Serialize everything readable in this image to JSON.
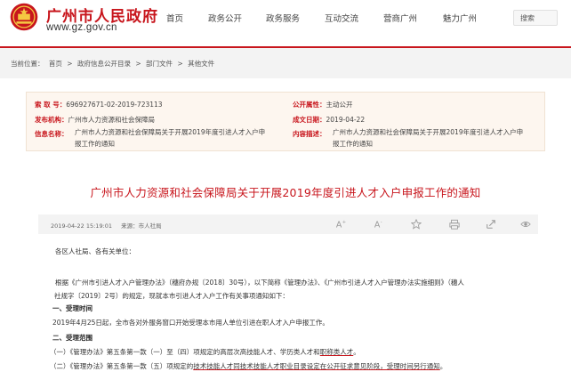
{
  "header": {
    "site_title": "广州市人民政府",
    "site_url": "www.gz.gov.cn",
    "nav": [
      "首页",
      "政务公开",
      "政务服务",
      "互动交流",
      "营商广州",
      "魅力广州"
    ],
    "search_label": "搜索",
    "accent_color": "#c8161d"
  },
  "breadcrumb": {
    "prefix": "当前位置：",
    "items": [
      "首页",
      "政府信息公开目录",
      "部门文件",
      "其他文件"
    ],
    "separator": ">"
  },
  "meta": {
    "index_label": "索 取 号：",
    "index_value": "696927671-02-2019-723113",
    "type_label": "公开属性：",
    "type_value": "主动公开",
    "issuer_label": "发布机构：",
    "issuer_value": "广州市人力资源和社会保障局",
    "date_label": "成文日期：",
    "date_value": "2019-04-22",
    "name_label": "信息名称：",
    "name_value_line1": "广州市人力资源和社会保障局关于开展2019年度引进人才入户申",
    "name_value_line2": "报工作的通知",
    "desc_label": "内容描述：",
    "desc_value_line1": "广州市人力资源和社会保障局关于开展2019年度引进人才入户申",
    "desc_value_line2": "报工作的通知"
  },
  "document": {
    "title": "广州市人力资源和社会保障局关于开展2019年度引进人才入户申报工作的通知",
    "published": "2019-04-22 15:19:01",
    "source_label": "来源：",
    "source_value": "市人社局",
    "toolbar_icons": [
      "font-larger-icon",
      "font-smaller-icon",
      "star-icon",
      "print-icon",
      "share-icon",
      "view-icon"
    ],
    "paragraphs": {
      "salutation": "各区人社局、各有关单位：",
      "intro_1": "根据《广州市引进人才入户管理办法》（穗府办规〔2018〕30号），以下简称《管理办法》、《广州市引进人才入户管理办法实施细则》（穗人",
      "intro_2": "社规字〔2019〕2号）的规定，现就本市引进人才入户工作有关事项通知如下：",
      "section_1": "一、受理时间",
      "section_1_body": "2019年4月25日起，全市各对外服务窗口开始受理本市用人单位引进在职人才入户申报工作。",
      "section_2": "二、受理范围",
      "item_1_pre": "（一）《管理办法》第五条第一款（一）至（四）项规定的高层次高技能人才、学历类人才和",
      "item_1_ul": "职称类人才",
      "item_1_post": "。",
      "item_2_pre": "（二）《管理办法》第五条第一款（五）项规定的",
      "item_2_ul": "技术技能人才同技术技能人才职业目录设定在公开征求意见阶段，受理时间另行通知",
      "item_2_post": "。"
    }
  }
}
